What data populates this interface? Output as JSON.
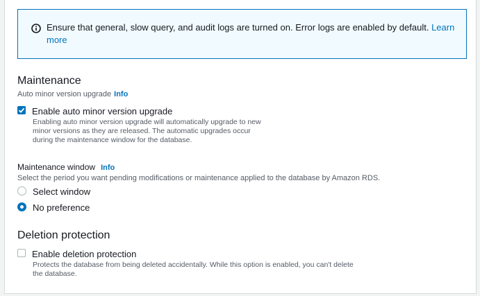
{
  "alert": {
    "text": "Ensure that general, slow query, and audit logs are turned on. Error logs are enabled by default.",
    "link": "Learn more",
    "icon": "info-circle-icon"
  },
  "maintenance": {
    "title": "Maintenance",
    "sublabel": "Auto minor version upgrade",
    "sublabel_info": "Info",
    "auto_upgrade": {
      "label": "Enable auto minor version upgrade",
      "checked": true,
      "description": "Enabling auto minor version upgrade will automatically upgrade to new minor versions as they are released. The automatic upgrades occur during the maintenance window for the database."
    },
    "window": {
      "label": "Maintenance window",
      "info": "Info",
      "description": "Select the period you want pending modifications or maintenance applied to the database by Amazon RDS.",
      "options": [
        {
          "label": "Select window",
          "selected": false
        },
        {
          "label": "No preference",
          "selected": true
        }
      ]
    }
  },
  "deletion": {
    "title": "Deletion protection",
    "checkbox": {
      "label": "Enable deletion protection",
      "checked": false,
      "description": "Protects the database from being deleted accidentally. While this option is enabled, you can't delete the database."
    }
  },
  "colors": {
    "accent": "#0073bb",
    "alert_bg": "#f1faff"
  }
}
